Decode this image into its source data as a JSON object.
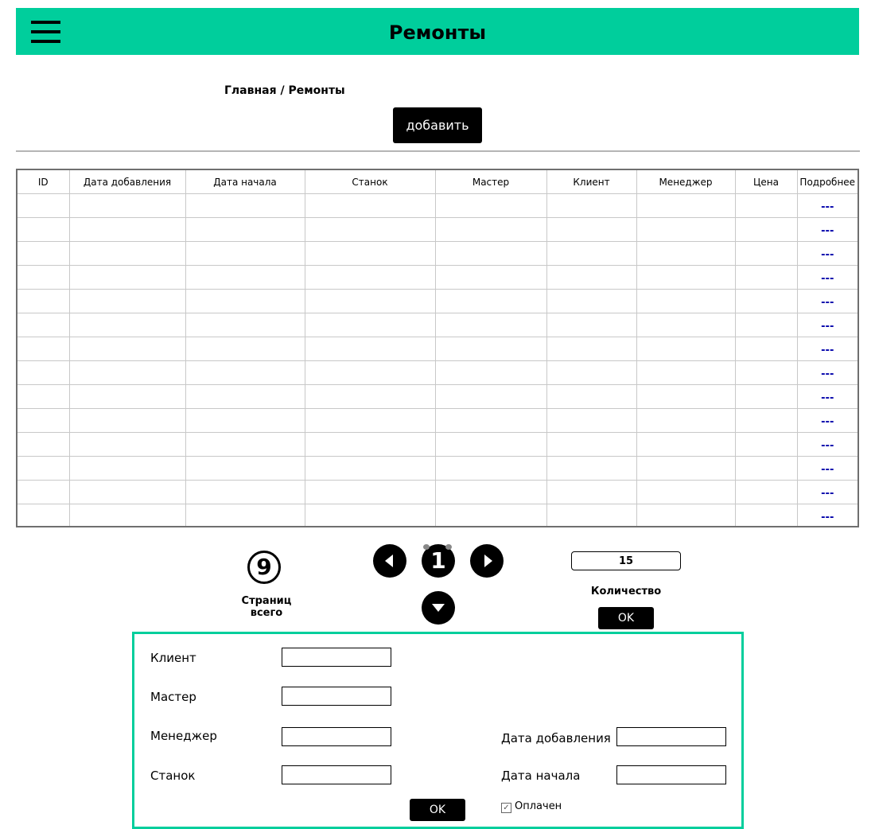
{
  "header": {
    "title": "Ремонты",
    "menu_icon": "hamburger-menu-icon",
    "color": "#00ce9c"
  },
  "breadcrumb": "Главная / Ремонты",
  "add_label": "добавить",
  "table": {
    "columns": [
      "ID",
      "Дата добавления",
      "Дата начала",
      "Станок",
      "Мастер",
      "Клиент",
      "Менеджер",
      "Цена",
      "Подробнее"
    ],
    "rows": [
      {
        "more": "---"
      },
      {
        "more": "---"
      },
      {
        "more": "---"
      },
      {
        "more": "---"
      },
      {
        "more": "---"
      },
      {
        "more": "---"
      },
      {
        "more": "---"
      },
      {
        "more": "---"
      },
      {
        "more": "---"
      },
      {
        "more": "---"
      },
      {
        "more": "---"
      },
      {
        "more": "---"
      },
      {
        "more": "---"
      },
      {
        "more": "---"
      }
    ]
  },
  "pagination": {
    "total_pages": "9",
    "total_label": "Страниц всего",
    "current_page": "1",
    "prev_icon": "triangle-left-icon",
    "next_icon": "triangle-right-icon",
    "down_icon": "triangle-down-icon"
  },
  "quantity": {
    "value": "15",
    "label": "Количество",
    "ok_label": "OK"
  },
  "filter": {
    "client_label": "Клиент",
    "master_label": "Мастер",
    "manager_label": "Менеджер",
    "machine_label": "Станок",
    "date_added_label": "Дата добавления",
    "date_start_label": "Дата начала",
    "paid_label": "Оплачен",
    "paid_checked": true,
    "ok_label": "OK",
    "border_color": "#00ce9c"
  }
}
